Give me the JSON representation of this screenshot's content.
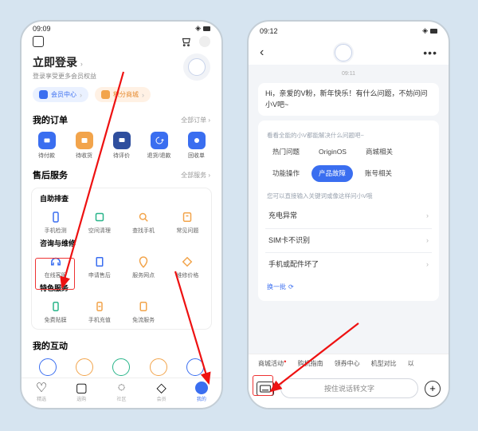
{
  "left": {
    "status_time": "09:09",
    "login_title": "立即登录",
    "login_sub": "登录享受更多会员权益",
    "pill_member": "会员中心",
    "pill_points": "积分商城",
    "orders_title": "我的订单",
    "orders_more": "全部订单",
    "order_tiles": [
      "待付款",
      "待收货",
      "待评价",
      "退货/退款",
      "回收单"
    ],
    "after_title": "售后服务",
    "after_more": "全部服务",
    "self_check": "自助排查",
    "self_items": [
      "手机检测",
      "空间清理",
      "查找手机",
      "常见问题"
    ],
    "consult": "咨询与维修",
    "consult_items": [
      "在线客服",
      "申请售后",
      "服务网点",
      "维修价格"
    ],
    "special": "特色服务",
    "special_items": [
      "免费贴膜",
      "手机充值",
      "免流服务"
    ],
    "interact": "我的互动",
    "nav": [
      "精选",
      "选购",
      "社区",
      "会员",
      "我的"
    ]
  },
  "right": {
    "status_time": "09:12",
    "chat_time": "09:11",
    "greeting": "Hi，亲爱的V粉，新年快乐！有什么问题，不妨问问小V吧~",
    "hint1": "看看全能的小V都能解决什么问题吧~",
    "chips": [
      "热门问题",
      "OriginOS",
      "商城相关",
      "功能操作",
      "产品故障",
      "账号相关"
    ],
    "hint2": "您可以直接输入关键词或像这样问小V哦",
    "questions": [
      "充电异常",
      "SIM卡不识别",
      "手机或配件坏了"
    ],
    "refresh": "换一批",
    "suggestions": [
      "商城活动",
      "购机指南",
      "领券中心",
      "机型对比",
      "以"
    ],
    "input_placeholder": "按住说话转文字"
  }
}
